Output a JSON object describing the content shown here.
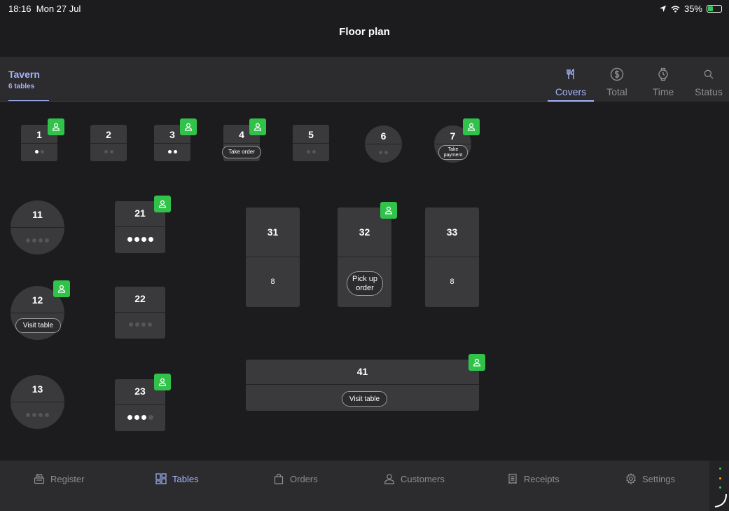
{
  "status": {
    "time": "18:16",
    "date": "Mon 27 Jul",
    "battery": "35%"
  },
  "nav": {
    "title": "Floor plan"
  },
  "area": {
    "name": "Tavern",
    "count": "6 tables"
  },
  "sort_tabs": [
    {
      "label": "Covers",
      "icon": "fork-knife-icon",
      "active": true
    },
    {
      "label": "Total",
      "icon": "dollar-circle-icon"
    },
    {
      "label": "Time",
      "icon": "watch-icon"
    },
    {
      "label": "Status",
      "icon": "search-icon"
    }
  ],
  "tables": [
    {
      "number": "1",
      "covers": 1,
      "capacity": 2,
      "guest": true
    },
    {
      "number": "2",
      "covers": 0,
      "capacity": 2,
      "guest": false
    },
    {
      "number": "3",
      "covers": 2,
      "capacity": 2,
      "guest": true
    },
    {
      "number": "4",
      "action": "Take order",
      "guest": true
    },
    {
      "number": "5",
      "covers": 0,
      "capacity": 2,
      "guest": false
    },
    {
      "number": "6",
      "covers": 0,
      "capacity": 2,
      "guest": false
    },
    {
      "number": "7",
      "action": "Take payment",
      "guest": true
    },
    {
      "number": "11",
      "covers": 0,
      "capacity": 4,
      "guest": false
    },
    {
      "number": "12",
      "action": "Visit table",
      "guest": true
    },
    {
      "number": "13",
      "covers": 0,
      "capacity": 4,
      "guest": false
    },
    {
      "number": "21",
      "covers": 4,
      "capacity": 4,
      "guest": true
    },
    {
      "number": "22",
      "covers": 0,
      "capacity": 4,
      "guest": false
    },
    {
      "number": "23",
      "covers": 3,
      "capacity": 4,
      "guest": true
    },
    {
      "number": "31",
      "seats": "8",
      "guest": false
    },
    {
      "number": "32",
      "action": "Pick up order",
      "guest": true
    },
    {
      "number": "33",
      "seats": "8",
      "guest": false
    },
    {
      "number": "41",
      "action": "Visit table",
      "guest": true
    }
  ],
  "tabbar": [
    {
      "label": "Register",
      "icon": "register-icon"
    },
    {
      "label": "Tables",
      "icon": "tables-grid-icon",
      "active": true
    },
    {
      "label": "Orders",
      "icon": "bag-icon"
    },
    {
      "label": "Customers",
      "icon": "customers-icon"
    },
    {
      "label": "Receipts",
      "icon": "receipt-icon"
    },
    {
      "label": "Settings",
      "icon": "gear-icon"
    }
  ],
  "colors": {
    "accent": "#a5b4fc",
    "guest_badge": "#30c24a",
    "table": "#3a3a3c",
    "background": "#1c1c1e"
  }
}
